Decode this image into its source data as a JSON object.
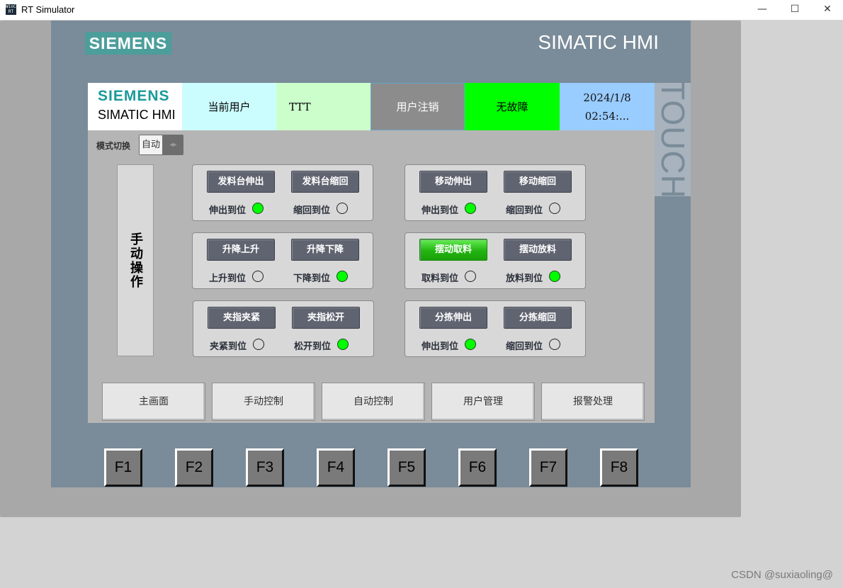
{
  "window": {
    "icon_text": "WinCC RT",
    "title": "RT Simulator",
    "minimize": "—",
    "maximize": "☐",
    "close": "✕"
  },
  "device": {
    "brand": "SIEMENS",
    "product": "SIMATIC HMI",
    "touch_label": "TOUCH"
  },
  "header": {
    "logo_brand": "SIEMENS",
    "logo_product": "SIMATIC HMI",
    "user_label": "当前用户",
    "user_value": "TTT",
    "logout": "用户注销",
    "status": "无故障",
    "date": "2024/1/8",
    "time": "02:54:..."
  },
  "mode": {
    "label": "模式切换",
    "value": "自动",
    "grip": "◂▸"
  },
  "manual_label": "手动操作",
  "groups": [
    {
      "btn1": "发料台伸出",
      "btn2": "发料台缩回",
      "lamp1_label": "伸出到位",
      "lamp1_on": true,
      "lamp2_label": "缩回到位",
      "lamp2_on": false,
      "btn1_active": false
    },
    {
      "btn1": "移动伸出",
      "btn2": "移动缩回",
      "lamp1_label": "伸出到位",
      "lamp1_on": true,
      "lamp2_label": "缩回到位",
      "lamp2_on": false,
      "btn1_active": false
    },
    {
      "btn1": "升降上升",
      "btn2": "升降下降",
      "lamp1_label": "上升到位",
      "lamp1_on": false,
      "lamp2_label": "下降到位",
      "lamp2_on": true,
      "btn1_active": false
    },
    {
      "btn1": "摆动取料",
      "btn2": "摆动放料",
      "lamp1_label": "取料到位",
      "lamp1_on": false,
      "lamp2_label": "放料到位",
      "lamp2_on": true,
      "btn1_active": true
    },
    {
      "btn1": "夹指夹紧",
      "btn2": "夹指松开",
      "lamp1_label": "夹紧到位",
      "lamp1_on": false,
      "lamp2_label": "松开到位",
      "lamp2_on": true,
      "btn1_active": false
    },
    {
      "btn1": "分拣伸出",
      "btn2": "分拣缩回",
      "lamp1_label": "伸出到位",
      "lamp1_on": true,
      "lamp2_label": "缩回到位",
      "lamp2_on": false,
      "btn1_active": false
    }
  ],
  "nav": [
    "主画面",
    "手动控制",
    "自动控制",
    "用户管理",
    "报警处理"
  ],
  "fkeys": [
    "F1",
    "F2",
    "F3",
    "F4",
    "F5",
    "F6",
    "F7",
    "F8"
  ],
  "watermark": "CSDN @suxiaoling@",
  "colors": {
    "lamp_on": "#00ff00",
    "status_ok": "#00ff00",
    "device_panel": "#7a8b99",
    "brand_teal": "#4c9e9b"
  }
}
